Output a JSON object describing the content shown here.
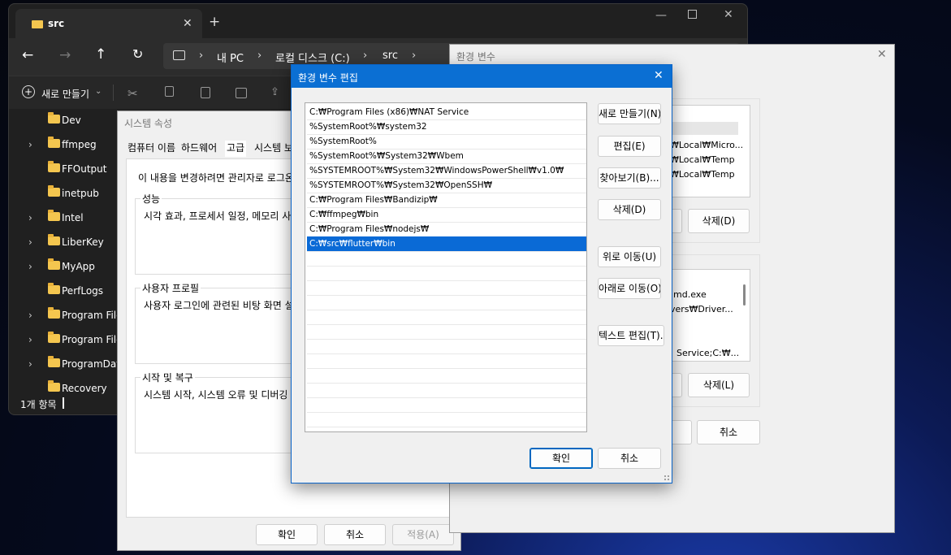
{
  "explorer": {
    "tab_title": "src",
    "breadcrumb": [
      "내 PC",
      "로컬 디스크 (C:)",
      "src"
    ],
    "new_button": "새로 만들기",
    "nav_items": [
      {
        "label": "Dev",
        "expandable": false
      },
      {
        "label": "ffmpeg",
        "expandable": true
      },
      {
        "label": "FFOutput",
        "expandable": false
      },
      {
        "label": "inetpub",
        "expandable": false
      },
      {
        "label": "Intel",
        "expandable": true
      },
      {
        "label": "LiberKey",
        "expandable": true
      },
      {
        "label": "MyApp",
        "expandable": true
      },
      {
        "label": "PerfLogs",
        "expandable": false
      },
      {
        "label": "Program Files",
        "expandable": true
      },
      {
        "label": "Program Files",
        "expandable": true
      },
      {
        "label": "ProgramData",
        "expandable": true
      },
      {
        "label": "Recovery",
        "expandable": false
      }
    ],
    "status": "1개 항목"
  },
  "sysprop": {
    "title": "시스템 속성",
    "tabs": [
      "컴퓨터 이름",
      "하드웨어",
      "고급",
      "시스템 보"
    ],
    "admin_note": "이 내용을 변경하려면 관리자로 로그온",
    "groups": [
      {
        "title": "성능",
        "text": "시각 효과, 프로세서 일정, 메모리 사"
      },
      {
        "title": "사용자 프로필",
        "text": "사용자 로그인에 관련된 비탕 화면 설"
      },
      {
        "title": "시작 및 복구",
        "text": "시스템 시작, 시스템 오류 및 디버깅"
      }
    ],
    "ok": "확인",
    "cancel": "취소",
    "apply": "적용(A)"
  },
  "envvars": {
    "title": "환경 변수",
    "user_vars": [
      "₩Local₩Micro...",
      "₩Local₩Temp",
      "₩Local₩Temp"
    ],
    "sys_vars": [
      "md.exe",
      "vers₩Driver...",
      "Service;C:₩..."
    ],
    "delete_user": "삭제(D)",
    "delete_sys": "삭제(L)",
    "cancel": "취소"
  },
  "editenv": {
    "title": "환경 변수 편집",
    "paths": [
      "C:₩Program Files (x86)₩NAT Service",
      "%SystemRoot%₩system32",
      "%SystemRoot%",
      "%SystemRoot%₩System32₩Wbem",
      "%SYSTEMROOT%₩System32₩WindowsPowerShell₩v1.0₩",
      "%SYSTEMROOT%₩System32₩OpenSSH₩",
      "C:₩Program Files₩Bandizip₩",
      "C:₩ffmpeg₩bin",
      "C:₩Program Files₩nodejs₩",
      "C:₩src₩flutter₩bin"
    ],
    "selected_index": 9,
    "buttons": {
      "new": "새로 만들기(N)",
      "edit": "편집(E)",
      "browse": "찾아보기(B)...",
      "delete": "삭제(D)",
      "move_up": "위로 이동(U)",
      "move_down": "아래로 이동(O)",
      "edit_text": "텍스트 편집(T)..."
    },
    "ok": "확인",
    "cancel": "취소"
  }
}
